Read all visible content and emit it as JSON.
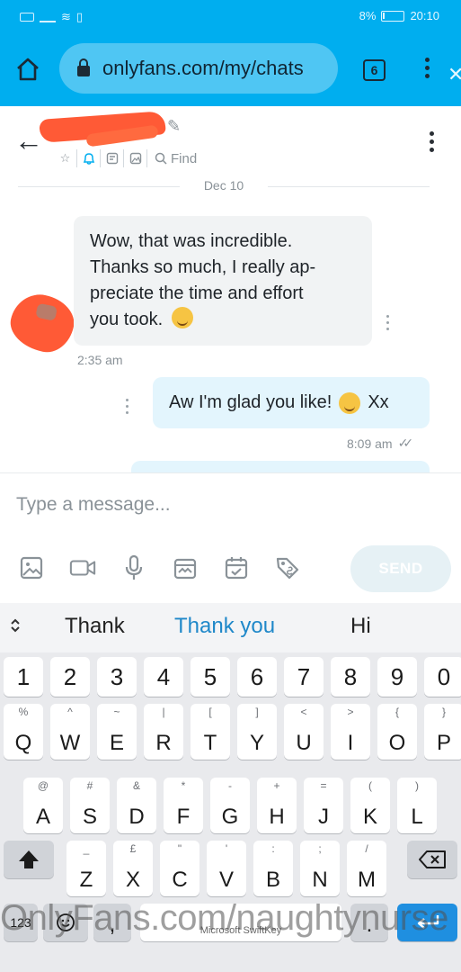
{
  "status_bar": {
    "battery": "8%",
    "time": "20:10"
  },
  "browser": {
    "url": "onlyfans.com/my/chats",
    "tab_count": "6"
  },
  "chat": {
    "find_label": "Find",
    "date": "Dec 10",
    "messages": [
      {
        "from": "them",
        "text_lines": [
          "Wow, that was incredible.",
          "Thanks so much, I really ap-",
          "preciate the time and effort",
          "you took."
        ],
        "time": "2:35 am"
      },
      {
        "from": "me",
        "text": "Aw I'm glad you like!",
        "suffix": "Xx",
        "time": "8:09 am"
      }
    ]
  },
  "composer": {
    "placeholder": "Type a message...",
    "send_label": "SEND"
  },
  "keyboard": {
    "suggestions": [
      "Thank",
      "Thank you",
      "Hi"
    ],
    "number_row": [
      "1",
      "2",
      "3",
      "4",
      "5",
      "6",
      "7",
      "8",
      "9",
      "0"
    ],
    "row1": [
      {
        "k": "Q",
        "h": "%"
      },
      {
        "k": "W",
        "h": "^"
      },
      {
        "k": "E",
        "h": "~"
      },
      {
        "k": "R",
        "h": "|"
      },
      {
        "k": "T",
        "h": "["
      },
      {
        "k": "Y",
        "h": "]"
      },
      {
        "k": "U",
        "h": "<"
      },
      {
        "k": "I",
        "h": ">"
      },
      {
        "k": "O",
        "h": "{"
      },
      {
        "k": "P",
        "h": "}"
      }
    ],
    "row2": [
      {
        "k": "A",
        "h": "@"
      },
      {
        "k": "S",
        "h": "#"
      },
      {
        "k": "D",
        "h": "&"
      },
      {
        "k": "F",
        "h": "*"
      },
      {
        "k": "G",
        "h": "-"
      },
      {
        "k": "H",
        "h": "+"
      },
      {
        "k": "J",
        "h": "="
      },
      {
        "k": "K",
        "h": "("
      },
      {
        "k": "L",
        "h": ")"
      }
    ],
    "row3": [
      {
        "k": "Z",
        "h": "_"
      },
      {
        "k": "X",
        "h": "£"
      },
      {
        "k": "C",
        "h": "\""
      },
      {
        "k": "V",
        "h": "'"
      },
      {
        "k": "B",
        "h": ":"
      },
      {
        "k": "N",
        "h": ";"
      },
      {
        "k": "M",
        "h": "/"
      }
    ],
    "symbols_key": "123",
    "comma_key": ",",
    "space_label": "Microsoft SwiftKey",
    "period_key": "."
  },
  "watermark": "OnlyFans.com/naughtynurse",
  "colors": {
    "brand": "#00aeef",
    "bubble_in": "#f1f3f4",
    "bubble_out": "#e3f5fd",
    "redaction": "#ff5a36"
  }
}
